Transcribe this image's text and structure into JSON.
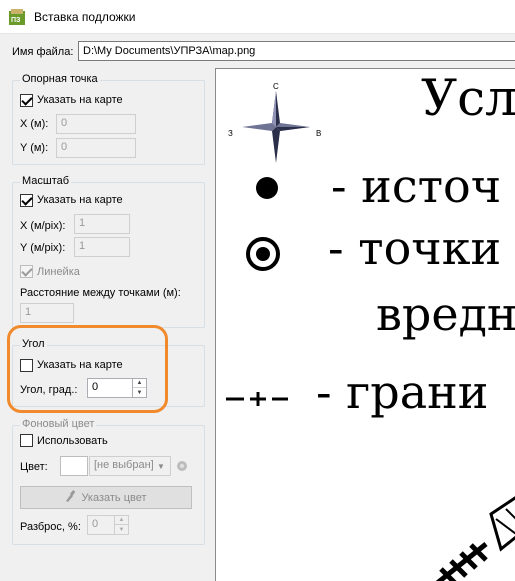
{
  "window": {
    "title": "Вставка подложки",
    "icon": "app-icon"
  },
  "file": {
    "label": "Имя файла:",
    "value": "D:\\My Documents\\УПРЗА\\map.png"
  },
  "reference_point": {
    "title": "Опорная точка",
    "pick_on_map": "Указать на карте",
    "x_label": "X (м):",
    "x_value": "0",
    "y_label": "Y (м):",
    "y_value": "0"
  },
  "scale": {
    "title": "Масштаб",
    "pick_on_map": "Указать на карте",
    "x_label": "X (м/pix):",
    "x_value": "1",
    "y_label": "Y (м/pix):",
    "y_value": "1",
    "ruler_label": "Линейка",
    "distance_label": "Расстояние между точками (м):",
    "distance_value": "1"
  },
  "angle": {
    "title": "Угол",
    "pick_on_map": "Указать на карте",
    "angle_label": "Угол, град.:",
    "angle_value": "0"
  },
  "background_color": {
    "title": "Фоновый цвет",
    "use_label": "Использовать",
    "color_label": "Цвет:",
    "color_value": "[не выбран]",
    "pick_button": "Указать цвет",
    "spread_label": "Разброс, %:",
    "spread_value": "0"
  },
  "map_preview": {
    "compass": {
      "n": "С",
      "w": "З",
      "e": "В"
    },
    "lines": [
      "Усл",
      "- источ",
      "- точки",
      "вредн",
      "- грани"
    ]
  },
  "colors": {
    "highlight": "#f08a2c"
  }
}
